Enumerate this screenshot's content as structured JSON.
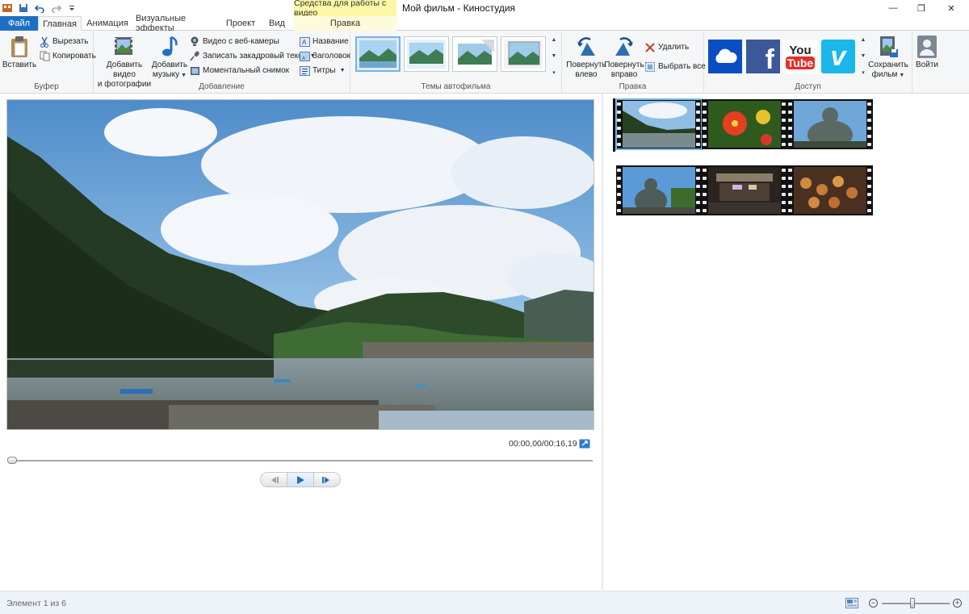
{
  "window": {
    "title": "Мой фильм - Киностудия",
    "contextual_group": "Средства для работы с видео",
    "controls": {
      "minimize": "—",
      "maximize": "❐",
      "close": "✕"
    }
  },
  "tabs": {
    "file": "Файл",
    "home": "Главная",
    "animation": "Анимация",
    "visual_effects": "Визуальные эффекты",
    "project": "Проект",
    "view": "Вид",
    "edit": "Правка"
  },
  "ribbon": {
    "clipboard": {
      "label": "Буфер",
      "paste": "Вставить",
      "cut": "Вырезать",
      "copy": "Копировать"
    },
    "add": {
      "label": "Добавление",
      "add_video_line1": "Добавить видео",
      "add_video_line2": "и фотографии",
      "add_music_line1": "Добавить",
      "add_music_line2": "музыку",
      "webcam": "Видео с веб-камеры",
      "narration": "Записать закадровый текст",
      "snapshot": "Моментальный снимок",
      "title": "Название",
      "caption": "Заголовок",
      "credits": "Титры"
    },
    "themes": {
      "label": "Темы автофильма"
    },
    "editing": {
      "label": "Правка",
      "rotate_left_line1": "Повернуть",
      "rotate_left_line2": "влево",
      "rotate_right_line1": "Повернуть",
      "rotate_right_line2": "вправо",
      "remove": "Удалить",
      "select_all": "Выбрать все"
    },
    "share": {
      "label": "Доступ",
      "save_movie_line1": "Сохранить",
      "save_movie_line2": "фильм",
      "onedrive": "cloud-icon",
      "facebook_glyph": "f",
      "youtube_top": "You",
      "youtube_bottom": "Tube",
      "vimeo_glyph": "v"
    },
    "signin": "Войти"
  },
  "preview": {
    "time": "00:00,00/00:16,19",
    "position": 0
  },
  "status": {
    "item_text": "Элемент 1 из 6",
    "zoom_level": 0.45
  },
  "colors": {
    "file_tab": "#1e6fc1",
    "contextual": "#fbf7a5",
    "facebook": "#3b5998",
    "youtube": "#e52d27",
    "vimeo": "#1ab7ea",
    "onedrive": "#0a4ec3"
  }
}
